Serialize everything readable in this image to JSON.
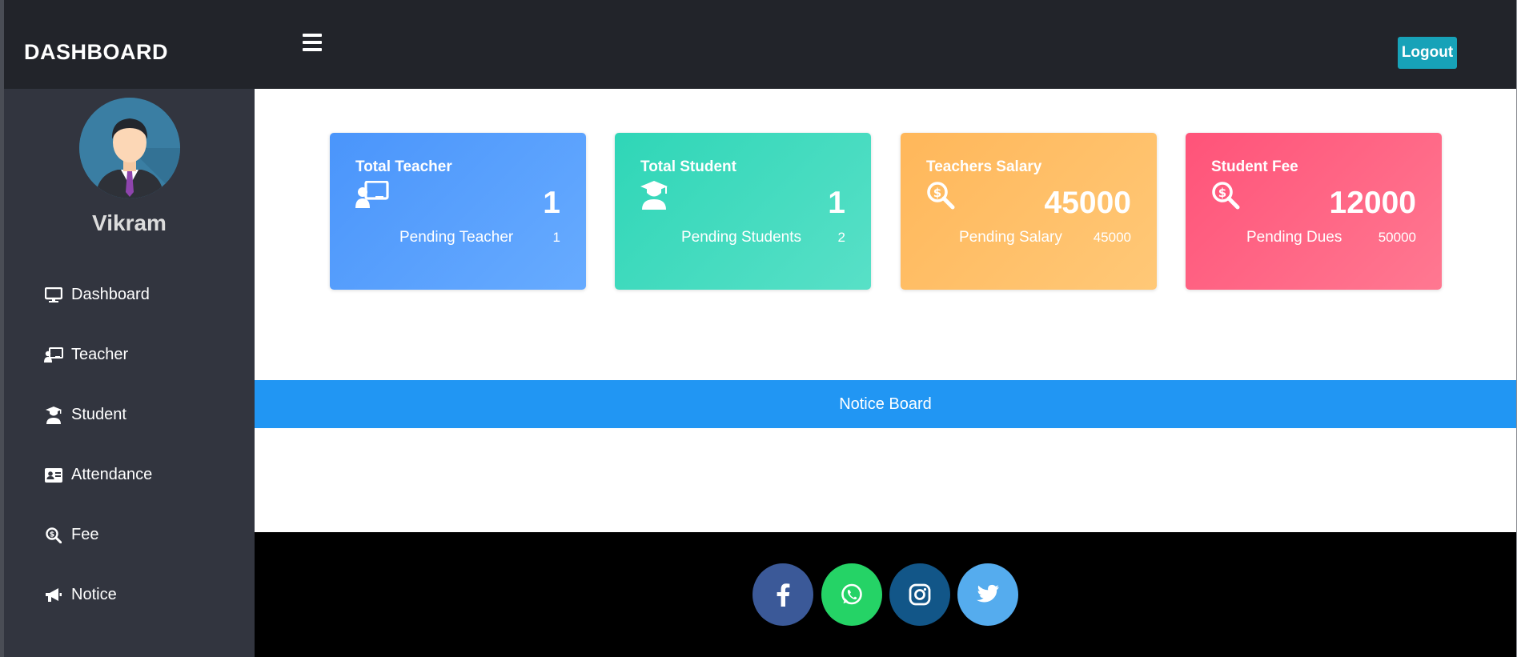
{
  "header": {
    "brand": "DASHBOARD",
    "logout_label": "Logout"
  },
  "sidebar": {
    "user_name": "Vikram",
    "items": [
      {
        "label": "Dashboard",
        "icon": "monitor-icon"
      },
      {
        "label": "Teacher",
        "icon": "teacher-icon"
      },
      {
        "label": "Student",
        "icon": "graduate-icon"
      },
      {
        "label": "Attendance",
        "icon": "id-card-icon"
      },
      {
        "label": "Fee",
        "icon": "search-dollar-icon"
      },
      {
        "label": "Notice",
        "icon": "megaphone-icon"
      }
    ]
  },
  "cards": [
    {
      "title": "Total Teacher",
      "value": "1",
      "pending_label": "Pending Teacher",
      "pending_value": "1",
      "icon": "teacher-icon",
      "color": "#4a95fb"
    },
    {
      "title": "Total Student",
      "value": "1",
      "pending_label": "Pending Students",
      "pending_value": "2",
      "icon": "graduate-icon",
      "color": "#2fd6b7"
    },
    {
      "title": "Teachers Salary",
      "value": "45000",
      "pending_label": "Pending Salary",
      "pending_value": "45000",
      "icon": "search-dollar-icon",
      "color": "#ffb75a"
    },
    {
      "title": "Student Fee",
      "value": "12000",
      "pending_label": "Pending Dues",
      "pending_value": "50000",
      "icon": "search-dollar-icon",
      "color": "#ff5379"
    }
  ],
  "notice_board": {
    "title": "Notice Board"
  },
  "footer": {
    "social": [
      {
        "name": "facebook-icon",
        "color": "#3b5998"
      },
      {
        "name": "whatsapp-icon",
        "color": "#25d366"
      },
      {
        "name": "instagram-icon",
        "color": "#125688"
      },
      {
        "name": "twitter-icon",
        "color": "#55acee"
      }
    ]
  },
  "colors": {
    "header_bg": "#22242a",
    "sidebar_bg": "#32353f",
    "accent": "#17a2b8",
    "notice_bg": "#2196f3"
  }
}
